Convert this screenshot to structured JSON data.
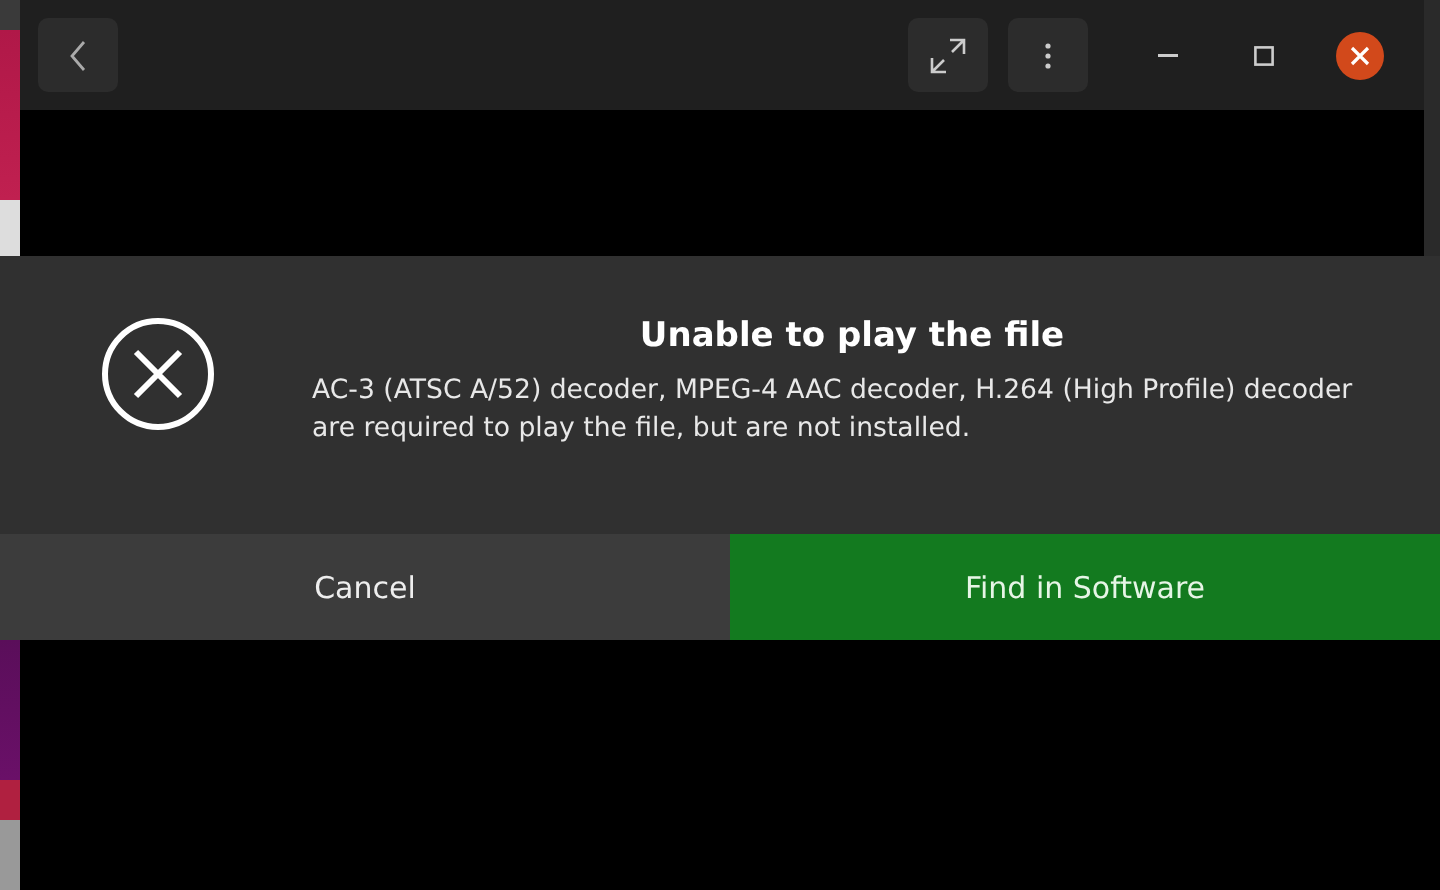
{
  "dialog": {
    "title": "Unable to play the file",
    "message": "AC-3 (ATSC A/52) decoder, MPEG-4 AAC decoder, H.264 (High Profile) decoder are required to play the file, but are not installed.",
    "buttons": [
      {
        "label": "Cancel",
        "kind": "cancel"
      },
      {
        "label": "Find in Software",
        "kind": "suggested"
      }
    ]
  }
}
